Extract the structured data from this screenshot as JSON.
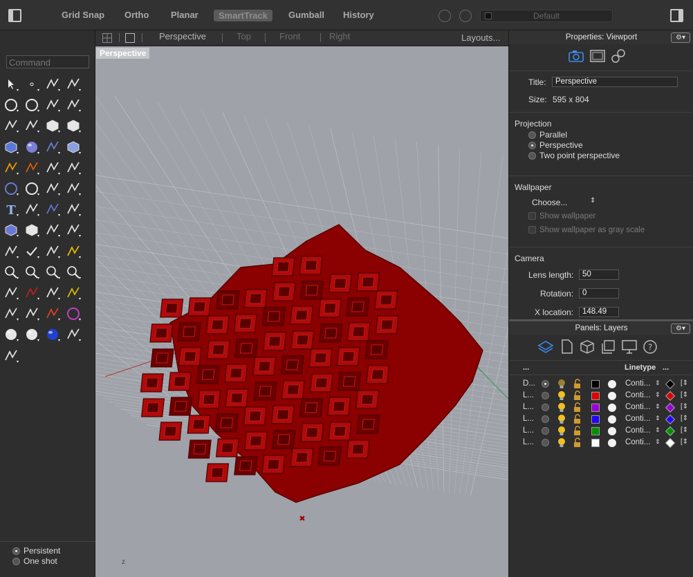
{
  "toolbar": {
    "items": [
      "Grid Snap",
      "Ortho",
      "Planar",
      "SmartTrack",
      "Gumball",
      "History"
    ],
    "active": "SmartTrack",
    "layer_dropdown": "Default"
  },
  "command": {
    "placeholder": "Command"
  },
  "osnap": {
    "persistent": "Persistent",
    "one_shot": "One shot"
  },
  "view_tabs": {
    "perspective": "Perspective",
    "top": "Top",
    "front": "Front",
    "right": "Right",
    "layouts": "Layouts..."
  },
  "viewport": {
    "label": "Perspective",
    "axis_z": "z"
  },
  "properties": {
    "header": "Properties: Viewport",
    "gear": "⚙▾",
    "title_label": "Title:",
    "title_value": "Perspective",
    "size_label": "Size:",
    "size_value": "595 x 804",
    "projection_label": "Projection",
    "projection_options": [
      "Parallel",
      "Perspective",
      "Two point perspective"
    ],
    "projection_selected": "Perspective",
    "wallpaper_label": "Wallpaper",
    "wallpaper_choose": "Choose...",
    "show_wallpaper": "Show wallpaper",
    "show_gray": "Show wallpaper as gray scale",
    "camera_label": "Camera",
    "lens_label": "Lens length:",
    "lens_value": "50",
    "rotation_label": "Rotation:",
    "rotation_value": "0",
    "xloc_label": "X location:",
    "xloc_value": "148.49"
  },
  "layers": {
    "header": "Panels: Layers",
    "gear": "⚙▾",
    "col_name": "...",
    "col_linetype": "Linetype",
    "col_more": "...",
    "rows": [
      {
        "name": "D...",
        "current": true,
        "color": "#000000",
        "linetype": "Conti...",
        "print": "#000000"
      },
      {
        "name": "L...",
        "current": false,
        "color": "#e00000",
        "linetype": "Conti...",
        "print": "#e00000"
      },
      {
        "name": "L...",
        "current": false,
        "color": "#9a00d6",
        "linetype": "Conti...",
        "print": "#9a00d6"
      },
      {
        "name": "L...",
        "current": false,
        "color": "#2200ff",
        "linetype": "Conti...",
        "print": "#2200ff"
      },
      {
        "name": "L...",
        "current": false,
        "color": "#009000",
        "linetype": "Conti...",
        "print": "#009000"
      },
      {
        "name": "L...",
        "current": false,
        "color": "#ffffff",
        "linetype": "Conti...",
        "print": "#ffffff"
      }
    ]
  },
  "colors": {
    "model": "#8b0000",
    "model_light": "#b00a0a",
    "grid": "#b8bbc0"
  }
}
